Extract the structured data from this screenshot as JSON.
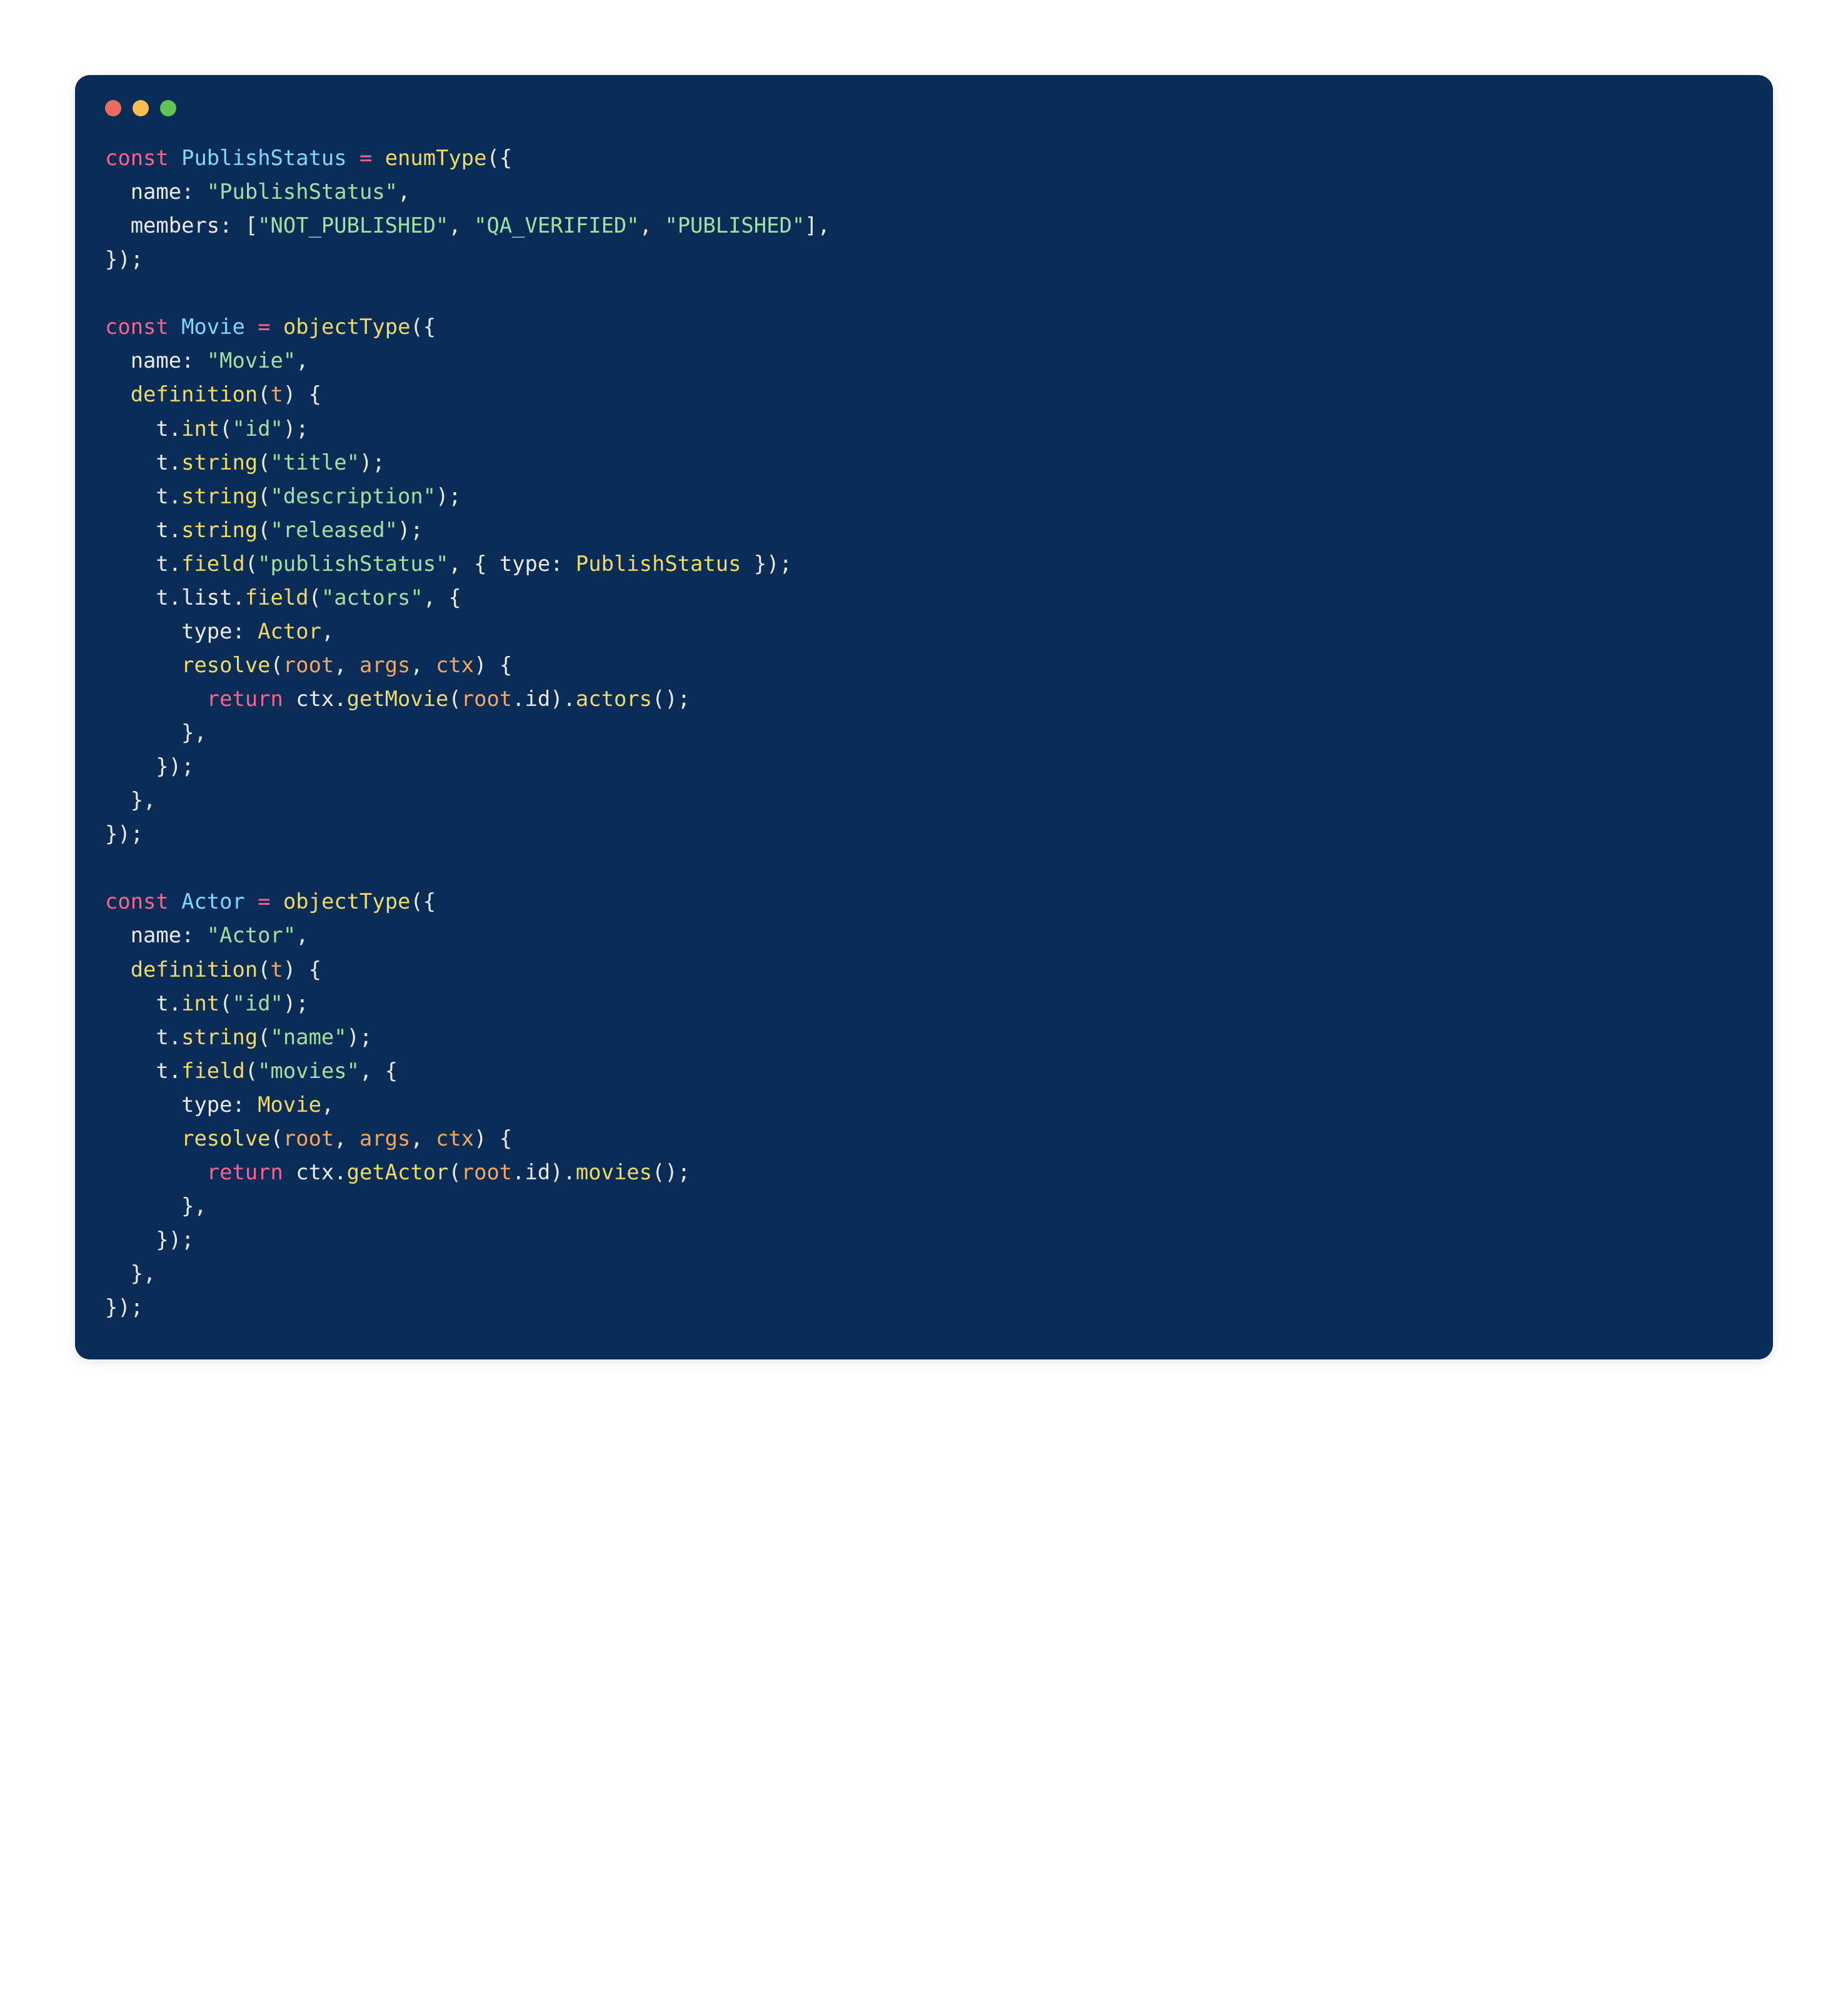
{
  "traffic_lights": [
    "red",
    "yellow",
    "green"
  ],
  "colors": {
    "background": "#0a2d57",
    "keyword": "#ff618a",
    "declaration": "#7fd6ff",
    "function": "#f1d968",
    "string": "#9fe29f",
    "argument": "#f7a45c",
    "default": "#eaeaea"
  },
  "tokens": [
    [
      {
        "cls": "kw",
        "t": "const"
      },
      {
        "cls": "punc",
        "t": " "
      },
      {
        "cls": "decl",
        "t": "PublishStatus"
      },
      {
        "cls": "punc",
        "t": " "
      },
      {
        "cls": "op",
        "t": "="
      },
      {
        "cls": "punc",
        "t": " "
      },
      {
        "cls": "fn",
        "t": "enumType"
      },
      {
        "cls": "punc",
        "t": "({"
      }
    ],
    [
      {
        "cls": "punc",
        "t": "  "
      },
      {
        "cls": "prop",
        "t": "name"
      },
      {
        "cls": "punc",
        "t": ": "
      },
      {
        "cls": "str",
        "t": "\"PublishStatus\""
      },
      {
        "cls": "punc",
        "t": ","
      }
    ],
    [
      {
        "cls": "punc",
        "t": "  "
      },
      {
        "cls": "prop",
        "t": "members"
      },
      {
        "cls": "punc",
        "t": ": ["
      },
      {
        "cls": "str",
        "t": "\"NOT_PUBLISHED\""
      },
      {
        "cls": "punc",
        "t": ", "
      },
      {
        "cls": "str",
        "t": "\"QA_VERIFIED\""
      },
      {
        "cls": "punc",
        "t": ", "
      },
      {
        "cls": "str",
        "t": "\"PUBLISHED\""
      },
      {
        "cls": "punc",
        "t": "],"
      }
    ],
    [
      {
        "cls": "punc",
        "t": "});"
      }
    ],
    [],
    [
      {
        "cls": "kw",
        "t": "const"
      },
      {
        "cls": "punc",
        "t": " "
      },
      {
        "cls": "decl",
        "t": "Movie"
      },
      {
        "cls": "punc",
        "t": " "
      },
      {
        "cls": "op",
        "t": "="
      },
      {
        "cls": "punc",
        "t": " "
      },
      {
        "cls": "fn",
        "t": "objectType"
      },
      {
        "cls": "punc",
        "t": "({"
      }
    ],
    [
      {
        "cls": "punc",
        "t": "  "
      },
      {
        "cls": "prop",
        "t": "name"
      },
      {
        "cls": "punc",
        "t": ": "
      },
      {
        "cls": "str",
        "t": "\"Movie\""
      },
      {
        "cls": "punc",
        "t": ","
      }
    ],
    [
      {
        "cls": "punc",
        "t": "  "
      },
      {
        "cls": "fn",
        "t": "definition"
      },
      {
        "cls": "punc",
        "t": "("
      },
      {
        "cls": "arg",
        "t": "t"
      },
      {
        "cls": "punc",
        "t": ") {"
      }
    ],
    [
      {
        "cls": "punc",
        "t": "    t."
      },
      {
        "cls": "fn",
        "t": "int"
      },
      {
        "cls": "punc",
        "t": "("
      },
      {
        "cls": "str",
        "t": "\"id\""
      },
      {
        "cls": "punc",
        "t": ");"
      }
    ],
    [
      {
        "cls": "punc",
        "t": "    t."
      },
      {
        "cls": "fn",
        "t": "string"
      },
      {
        "cls": "punc",
        "t": "("
      },
      {
        "cls": "str",
        "t": "\"title\""
      },
      {
        "cls": "punc",
        "t": ");"
      }
    ],
    [
      {
        "cls": "punc",
        "t": "    t."
      },
      {
        "cls": "fn",
        "t": "string"
      },
      {
        "cls": "punc",
        "t": "("
      },
      {
        "cls": "str",
        "t": "\"description\""
      },
      {
        "cls": "punc",
        "t": ");"
      }
    ],
    [
      {
        "cls": "punc",
        "t": "    t."
      },
      {
        "cls": "fn",
        "t": "string"
      },
      {
        "cls": "punc",
        "t": "("
      },
      {
        "cls": "str",
        "t": "\"released\""
      },
      {
        "cls": "punc",
        "t": ");"
      }
    ],
    [
      {
        "cls": "punc",
        "t": "    t."
      },
      {
        "cls": "fn",
        "t": "field"
      },
      {
        "cls": "punc",
        "t": "("
      },
      {
        "cls": "str",
        "t": "\"publishStatus\""
      },
      {
        "cls": "punc",
        "t": ", { "
      },
      {
        "cls": "prop",
        "t": "type"
      },
      {
        "cls": "punc",
        "t": ": "
      },
      {
        "cls": "fn",
        "t": "PublishStatus"
      },
      {
        "cls": "punc",
        "t": " });"
      }
    ],
    [
      {
        "cls": "punc",
        "t": "    t.list."
      },
      {
        "cls": "fn",
        "t": "field"
      },
      {
        "cls": "punc",
        "t": "("
      },
      {
        "cls": "str",
        "t": "\"actors\""
      },
      {
        "cls": "punc",
        "t": ", {"
      }
    ],
    [
      {
        "cls": "punc",
        "t": "      "
      },
      {
        "cls": "prop",
        "t": "type"
      },
      {
        "cls": "punc",
        "t": ": "
      },
      {
        "cls": "fn",
        "t": "Actor"
      },
      {
        "cls": "punc",
        "t": ","
      }
    ],
    [
      {
        "cls": "punc",
        "t": "      "
      },
      {
        "cls": "fn",
        "t": "resolve"
      },
      {
        "cls": "punc",
        "t": "("
      },
      {
        "cls": "arg",
        "t": "root"
      },
      {
        "cls": "punc",
        "t": ", "
      },
      {
        "cls": "arg",
        "t": "args"
      },
      {
        "cls": "punc",
        "t": ", "
      },
      {
        "cls": "arg",
        "t": "ctx"
      },
      {
        "cls": "punc",
        "t": ") {"
      }
    ],
    [
      {
        "cls": "punc",
        "t": "        "
      },
      {
        "cls": "kw",
        "t": "return"
      },
      {
        "cls": "punc",
        "t": " ctx."
      },
      {
        "cls": "fn",
        "t": "getMovie"
      },
      {
        "cls": "punc",
        "t": "("
      },
      {
        "cls": "arg",
        "t": "root"
      },
      {
        "cls": "punc",
        "t": ".id)."
      },
      {
        "cls": "fn",
        "t": "actors"
      },
      {
        "cls": "punc",
        "t": "();"
      }
    ],
    [
      {
        "cls": "punc",
        "t": "      },"
      }
    ],
    [
      {
        "cls": "punc",
        "t": "    });"
      }
    ],
    [
      {
        "cls": "punc",
        "t": "  },"
      }
    ],
    [
      {
        "cls": "punc",
        "t": "});"
      }
    ],
    [],
    [
      {
        "cls": "kw",
        "t": "const"
      },
      {
        "cls": "punc",
        "t": " "
      },
      {
        "cls": "decl",
        "t": "Actor"
      },
      {
        "cls": "punc",
        "t": " "
      },
      {
        "cls": "op",
        "t": "="
      },
      {
        "cls": "punc",
        "t": " "
      },
      {
        "cls": "fn",
        "t": "objectType"
      },
      {
        "cls": "punc",
        "t": "({"
      }
    ],
    [
      {
        "cls": "punc",
        "t": "  "
      },
      {
        "cls": "prop",
        "t": "name"
      },
      {
        "cls": "punc",
        "t": ": "
      },
      {
        "cls": "str",
        "t": "\"Actor\""
      },
      {
        "cls": "punc",
        "t": ","
      }
    ],
    [
      {
        "cls": "punc",
        "t": "  "
      },
      {
        "cls": "fn",
        "t": "definition"
      },
      {
        "cls": "punc",
        "t": "("
      },
      {
        "cls": "arg",
        "t": "t"
      },
      {
        "cls": "punc",
        "t": ") {"
      }
    ],
    [
      {
        "cls": "punc",
        "t": "    t."
      },
      {
        "cls": "fn",
        "t": "int"
      },
      {
        "cls": "punc",
        "t": "("
      },
      {
        "cls": "str",
        "t": "\"id\""
      },
      {
        "cls": "punc",
        "t": ");"
      }
    ],
    [
      {
        "cls": "punc",
        "t": "    t."
      },
      {
        "cls": "fn",
        "t": "string"
      },
      {
        "cls": "punc",
        "t": "("
      },
      {
        "cls": "str",
        "t": "\"name\""
      },
      {
        "cls": "punc",
        "t": ");"
      }
    ],
    [
      {
        "cls": "punc",
        "t": "    t."
      },
      {
        "cls": "fn",
        "t": "field"
      },
      {
        "cls": "punc",
        "t": "("
      },
      {
        "cls": "str",
        "t": "\"movies\""
      },
      {
        "cls": "punc",
        "t": ", {"
      }
    ],
    [
      {
        "cls": "punc",
        "t": "      "
      },
      {
        "cls": "prop",
        "t": "type"
      },
      {
        "cls": "punc",
        "t": ": "
      },
      {
        "cls": "fn",
        "t": "Movie"
      },
      {
        "cls": "punc",
        "t": ","
      }
    ],
    [
      {
        "cls": "punc",
        "t": "      "
      },
      {
        "cls": "fn",
        "t": "resolve"
      },
      {
        "cls": "punc",
        "t": "("
      },
      {
        "cls": "arg",
        "t": "root"
      },
      {
        "cls": "punc",
        "t": ", "
      },
      {
        "cls": "arg",
        "t": "args"
      },
      {
        "cls": "punc",
        "t": ", "
      },
      {
        "cls": "arg",
        "t": "ctx"
      },
      {
        "cls": "punc",
        "t": ") {"
      }
    ],
    [
      {
        "cls": "punc",
        "t": "        "
      },
      {
        "cls": "kw",
        "t": "return"
      },
      {
        "cls": "punc",
        "t": " ctx."
      },
      {
        "cls": "fn",
        "t": "getActor"
      },
      {
        "cls": "punc",
        "t": "("
      },
      {
        "cls": "arg",
        "t": "root"
      },
      {
        "cls": "punc",
        "t": ".id)."
      },
      {
        "cls": "fn",
        "t": "movies"
      },
      {
        "cls": "punc",
        "t": "();"
      }
    ],
    [
      {
        "cls": "punc",
        "t": "      },"
      }
    ],
    [
      {
        "cls": "punc",
        "t": "    });"
      }
    ],
    [
      {
        "cls": "punc",
        "t": "  },"
      }
    ],
    [
      {
        "cls": "punc",
        "t": "});"
      }
    ]
  ]
}
